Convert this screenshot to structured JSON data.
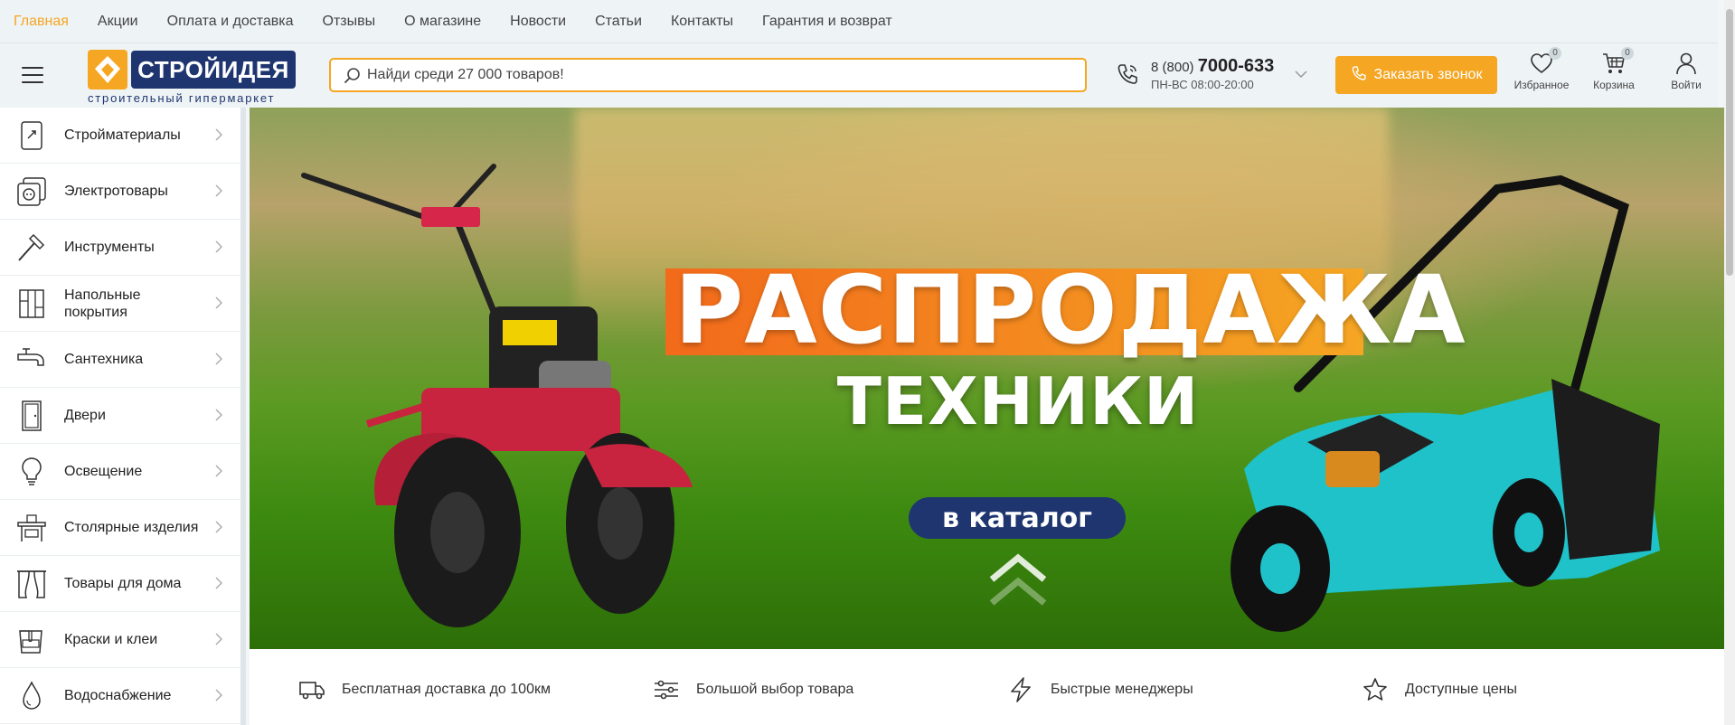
{
  "topnav": {
    "items": [
      "Главная",
      "Акции",
      "Оплата и доставка",
      "Отзывы",
      "О магазине",
      "Новости",
      "Статьи",
      "Контакты",
      "Гарантия и возврат"
    ]
  },
  "logo": {
    "name": "СТРОЙИДЕЯ",
    "tagline": "строительный гипермаркет"
  },
  "search": {
    "placeholder": "Найди среди 27 000 товаров!"
  },
  "phone": {
    "prefix": "8 (800)",
    "number": "7000-633",
    "hours": "ПН-ВС 08:00-20:00"
  },
  "callback": {
    "label": "Заказать звонок"
  },
  "header_icons": {
    "favorites": {
      "label": "Избранное",
      "count": "0"
    },
    "cart": {
      "label": "Корзина",
      "count": "0"
    },
    "login": {
      "label": "Войти"
    }
  },
  "sidebar": {
    "items": [
      {
        "label": "Стройматериалы",
        "icon": "building-materials-icon"
      },
      {
        "label": "Электротовары",
        "icon": "socket-icon"
      },
      {
        "label": "Инструменты",
        "icon": "hammer-icon"
      },
      {
        "label": "Напольные покрытия",
        "icon": "flooring-icon"
      },
      {
        "label": "Сантехника",
        "icon": "faucet-icon"
      },
      {
        "label": "Двери",
        "icon": "door-icon"
      },
      {
        "label": "Освещение",
        "icon": "bulb-icon"
      },
      {
        "label": "Столярные изделия",
        "icon": "table-icon"
      },
      {
        "label": "Товары для дома",
        "icon": "curtains-icon"
      },
      {
        "label": "Краски и клеи",
        "icon": "paint-bucket-icon"
      },
      {
        "label": "Водоснабжение",
        "icon": "water-drop-icon"
      }
    ]
  },
  "banner": {
    "title": "РАСПРОДАЖА",
    "subtitle": "ТЕХНИКИ",
    "button": "в каталог"
  },
  "features": [
    {
      "label": "Бесплатная доставка до 100км",
      "icon": "truck-icon"
    },
    {
      "label": "Большой выбор товара",
      "icon": "sliders-icon"
    },
    {
      "label": "Быстрые менеджеры",
      "icon": "lightning-icon"
    },
    {
      "label": "Доступные цены",
      "icon": "star-icon"
    }
  ],
  "colors": {
    "accent": "#f5a623",
    "brand": "#1e3570"
  }
}
